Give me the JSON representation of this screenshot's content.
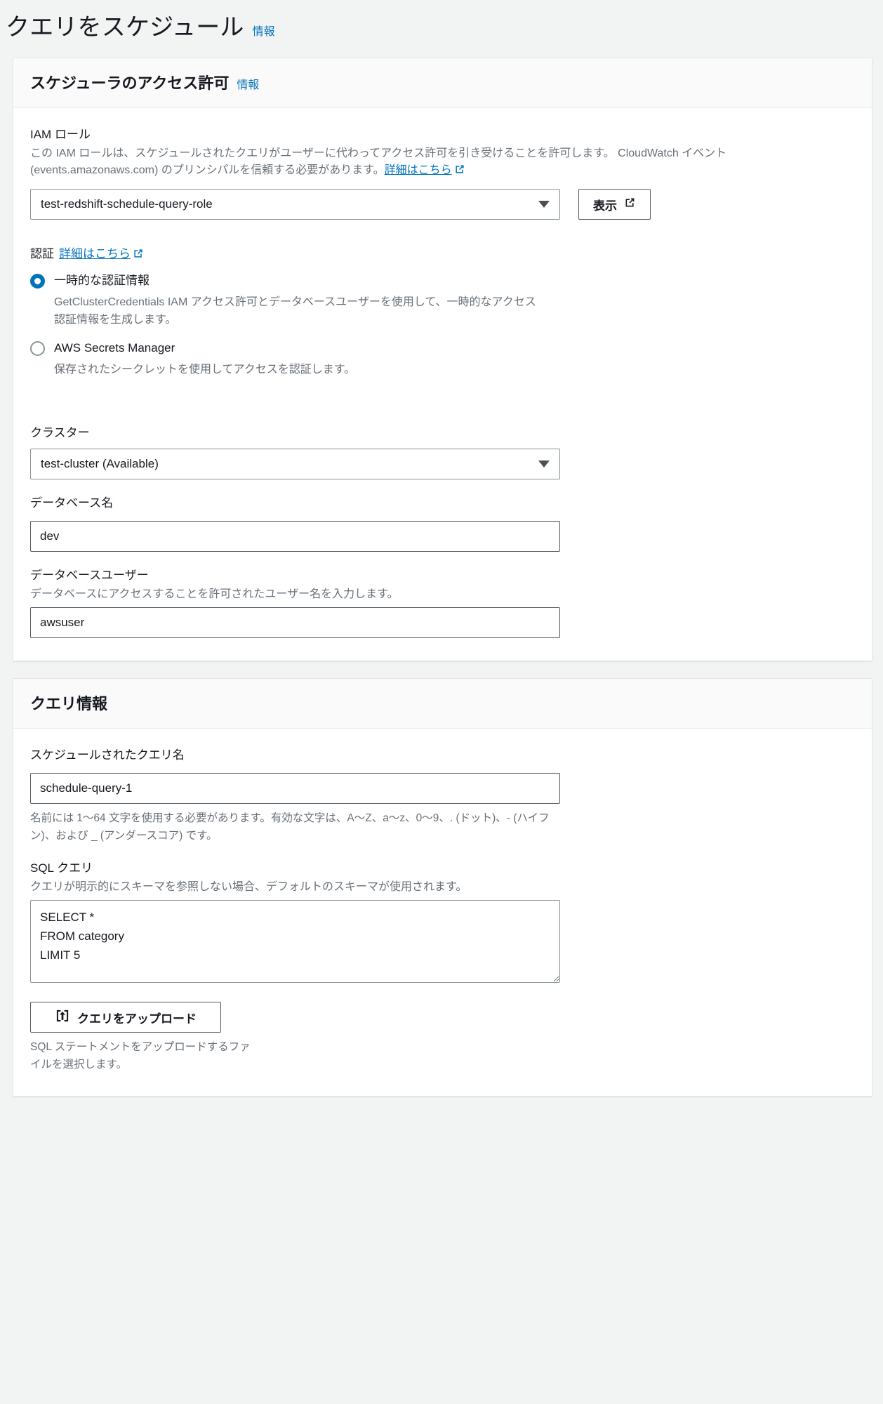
{
  "page": {
    "title": "クエリをスケジュール",
    "info_label": "情報"
  },
  "scheduler_permissions": {
    "header": "スケジューラのアクセス許可",
    "info_label": "情報",
    "iam_role": {
      "label": "IAM ロール",
      "description_line1": "この IAM ロールは、スケジュールされたクエリがユーザーに代わってアクセス許可を引き受けることを許可します。",
      "description_line2": "CloudWatch イベント (events.amazonaws.com) のプリンシパルを信頼する必要があります。",
      "learn_more": "詳細はこちら",
      "selected": "test-redshift-schedule-query-role",
      "view_button": "表示"
    },
    "authentication": {
      "label": "認証",
      "learn_more": "詳細はこちら",
      "options": [
        {
          "label": "一時的な認証情報",
          "description": "GetClusterCredentials IAM アクセス許可とデータベースユーザーを使用して、一時的なアクセス認証情報を生成します。",
          "selected": true
        },
        {
          "label": "AWS Secrets Manager",
          "description": "保存されたシークレットを使用してアクセスを認証します。",
          "selected": false
        }
      ]
    },
    "cluster": {
      "label": "クラスター",
      "selected": "test-cluster (Available)"
    },
    "database_name": {
      "label": "データベース名",
      "value": "dev"
    },
    "database_user": {
      "label": "データベースユーザー",
      "description": "データベースにアクセスすることを許可されたユーザー名を入力します。",
      "value": "awsuser"
    }
  },
  "query_information": {
    "header": "クエリ情報",
    "query_name": {
      "label": "スケジュールされたクエリ名",
      "value": "schedule-query-1",
      "help": "名前には 1〜64 文字を使用する必要があります。有効な文字は、A〜Z、a〜z、0〜9、. (ドット)、- (ハイフン)、および _ (アンダースコア) です。"
    },
    "sql_query": {
      "label": "SQL クエリ",
      "description": "クエリが明示的にスキーマを参照しない場合、デフォルトのスキーマが使用されます。",
      "value": "SELECT *\nFROM category\nLIMIT 5"
    },
    "upload": {
      "button_label": "クエリをアップロード",
      "help": "SQL ステートメントをアップロードするファイルを選択します。"
    }
  },
  "colors": {
    "link": "#0073bb",
    "radio_selected": "#0073bb",
    "page_background": "#f2f3f3",
    "panel_background": "#ffffff",
    "panel_header_background": "#fafafa",
    "text": "#16191f",
    "muted_text": "#687078"
  }
}
